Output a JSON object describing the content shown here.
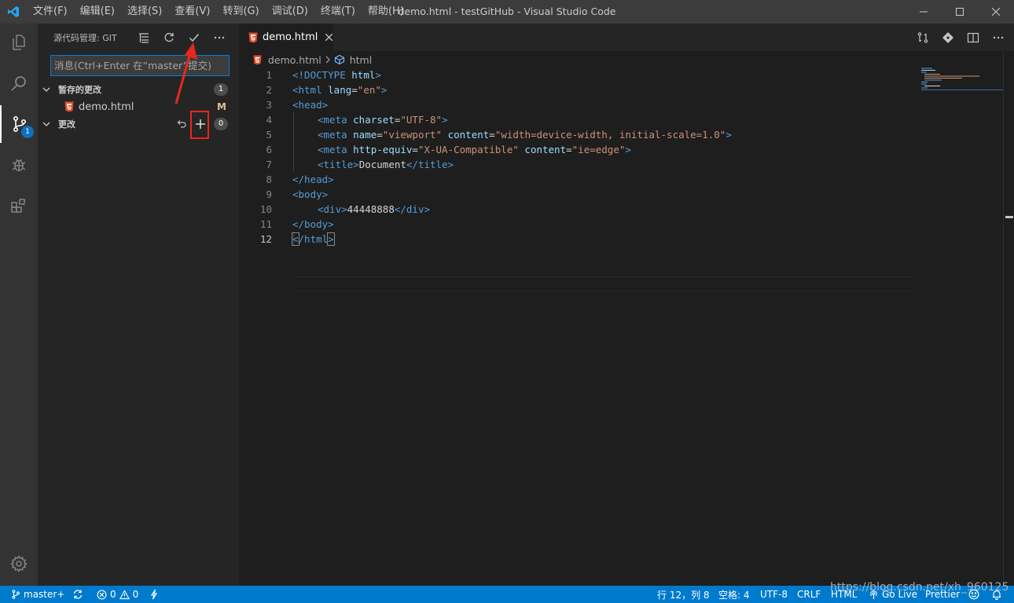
{
  "window": {
    "title": "demo.html - testGitHub - Visual Studio Code"
  },
  "menu": [
    "文件(F)",
    "编辑(E)",
    "选择(S)",
    "查看(V)",
    "转到(G)",
    "调试(D)",
    "终端(T)",
    "帮助(H)"
  ],
  "activity_bar": {
    "scm_badge": "1"
  },
  "sidebar": {
    "title": "源代码管理: GIT",
    "message_placeholder": "消息(Ctrl+Enter 在“master”提交)",
    "staged": {
      "label": "暂存的更改",
      "count": "1"
    },
    "file": {
      "name": "demo.html",
      "status": "M"
    },
    "changes": {
      "label": "更改",
      "count": "0"
    }
  },
  "editor": {
    "tab": "demo.html",
    "breadcrumb": {
      "file": "demo.html",
      "symbol": "html"
    },
    "line_numbers": [
      "1",
      "2",
      "3",
      "4",
      "5",
      "6",
      "7",
      "8",
      "9",
      "10",
      "11",
      "12"
    ]
  },
  "code": {
    "l1": {
      "a": "<!DOCTYPE ",
      "b": "html",
      "c": ">"
    },
    "l2": {
      "a": "<html ",
      "b": "lang",
      "c": "=",
      "d": "\"en\"",
      "e": ">"
    },
    "l3": {
      "a": "<head>"
    },
    "l4": {
      "a": "<meta ",
      "b": "charset",
      "c": "=",
      "d": "\"UTF-8\"",
      "e": ">"
    },
    "l5": {
      "a": "<meta ",
      "b": "name",
      "c": "=",
      "d": "\"viewport\"",
      "e": " content",
      "f": "=",
      "g": "\"width=device-width, initial-scale=1.0\"",
      "h": ">"
    },
    "l6": {
      "a": "<meta ",
      "b": "http-equiv",
      "c": "=",
      "d": "\"X-UA-Compatible\"",
      "e": " content",
      "f": "=",
      "g": "\"ie=edge\"",
      "h": ">"
    },
    "l7": {
      "a": "<title>",
      "b": "Document",
      "c": "</title>"
    },
    "l8": {
      "a": "</head>"
    },
    "l9": {
      "a": "<body>"
    },
    "l10": {
      "a": "<div>",
      "b": "44448888",
      "c": "</div>"
    },
    "l11": {
      "a": "</body>"
    },
    "l12": {
      "a": "<",
      "b": "/html",
      "c": ">"
    }
  },
  "status": {
    "branch": "master+",
    "errors": "0",
    "warnings": "0",
    "position": "行 12，列 8",
    "spaces": "空格: 4",
    "encoding": "UTF-8",
    "eol": "CRLF",
    "language": "HTML",
    "golive": "Go Live",
    "prettier": "Prettier"
  },
  "watermark": "https://blog.csdn.net/xh_960125",
  "colors": {
    "accent": "#007acc",
    "annotation": "#e8281d",
    "badge": "#0e70c0",
    "html_icon": "#e44d26"
  }
}
